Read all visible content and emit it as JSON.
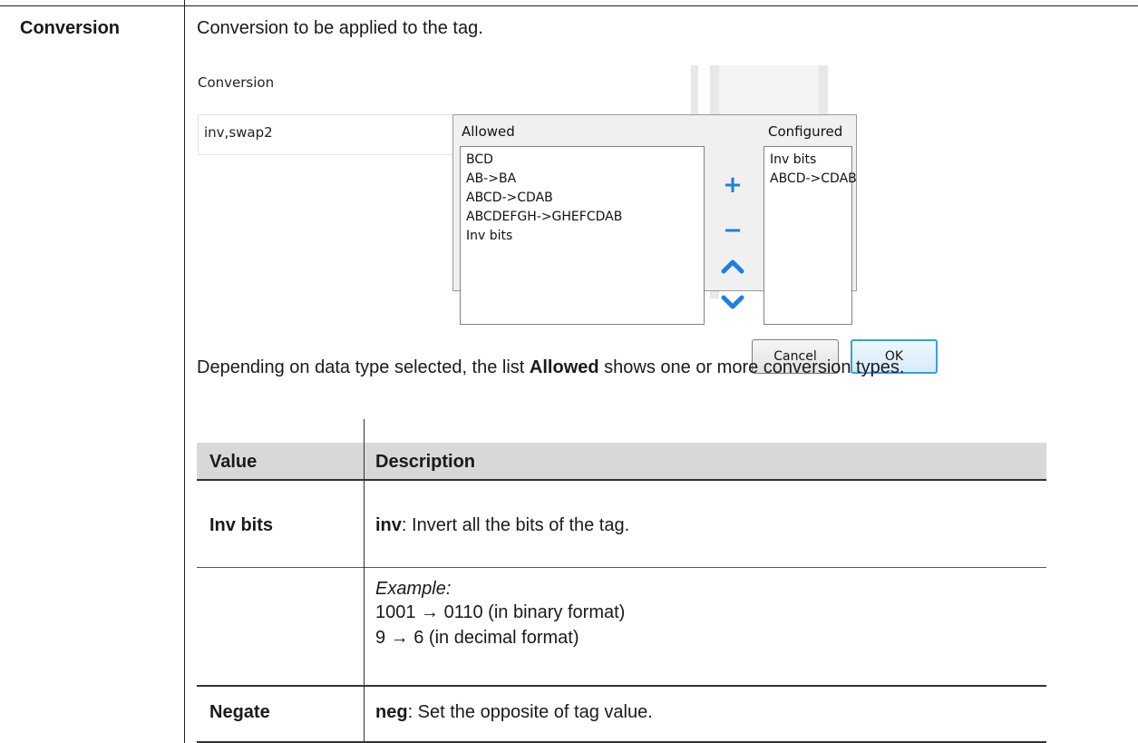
{
  "row_label": "Conversion",
  "description": "Conversion to be applied to the tag.",
  "screenshot": {
    "conversion_label": "Conversion",
    "conversion_value": "inv,swap2",
    "allowed_title": "Allowed",
    "configured_title": "Configured",
    "allowed_items": [
      "BCD",
      "AB->BA",
      "ABCD->CDAB",
      "ABCDEFGH->GHEFCDAB",
      "Inv bits"
    ],
    "configured_items": [
      "Inv bits",
      "ABCD->CDAB"
    ],
    "controls": {
      "add": "+",
      "remove": "−",
      "up": "⌃",
      "down": "⌄"
    },
    "cancel_label": "Cancel",
    "ok_label": "OK"
  },
  "after_text": {
    "pre": "Depending on data type selected, the list ",
    "bold": "Allowed",
    "post": " shows one or more conversion types."
  },
  "table": {
    "headers": [
      "Value",
      "Description"
    ],
    "rows": [
      {
        "value": "Inv bits",
        "code": "inv",
        "text": ": Invert all the bits of the tag.",
        "example_label": "Example:",
        "example_lines": [
          "1001 → 0110 (in binary format)",
          "9 → 6 (in decimal format)"
        ]
      },
      {
        "value": "Negate",
        "code": "neg",
        "text": ": Set the opposite of tag value."
      }
    ]
  },
  "colors": {
    "accent_blue": "#1f7fe0",
    "header_gray": "#d8d8d8"
  }
}
